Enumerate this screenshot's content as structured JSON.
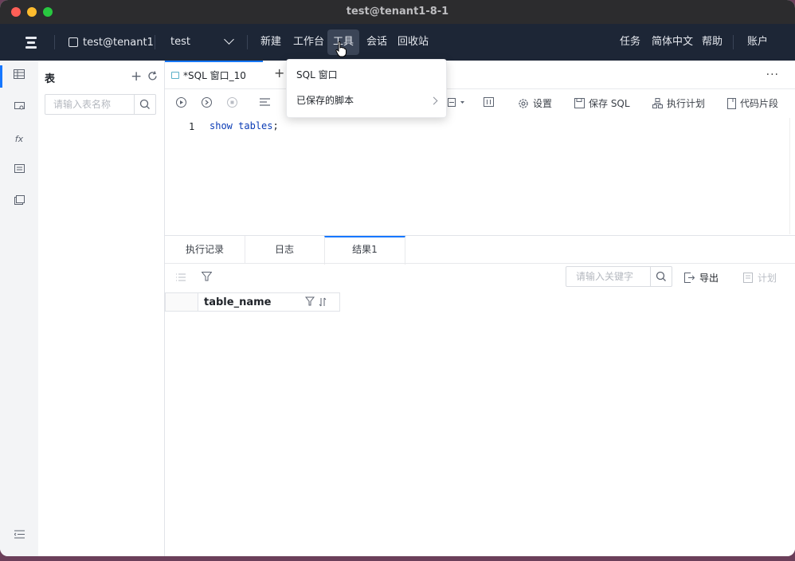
{
  "window": {
    "title": "test@tenant1-8-1"
  },
  "topnav": {
    "connection": "test@tenant1",
    "database": "test",
    "menu_left": [
      "新建",
      "工作台",
      "工具",
      "会话",
      "回收站"
    ],
    "menu_right": [
      "任务",
      "简体中文",
      "帮助",
      "账户"
    ],
    "active_menu": "工具"
  },
  "table_panel": {
    "title": "表",
    "search_placeholder": "请输入表名称"
  },
  "editor": {
    "tab_label": "*SQL 窗口_10",
    "more": "···",
    "toolbar": {
      "settings": "设置",
      "save_sql": "保存 SQL",
      "exec_plan": "执行计划",
      "snippets": "代码片段"
    },
    "line_number": "1",
    "code_keyword1": "show",
    "code_keyword2": "tables",
    "code_punct": ";"
  },
  "result": {
    "tabs": [
      "执行记录",
      "日志",
      "结果1"
    ],
    "active_tab": "结果1",
    "search_placeholder": "请输入关键字",
    "export": "导出",
    "plan": "计划",
    "columns": [
      "table_name"
    ]
  },
  "dropdown": {
    "items": [
      "SQL 窗口",
      "已保存的脚本"
    ]
  },
  "colors": {
    "accent": "#1677ff",
    "nav_bg": "#1d2636"
  }
}
